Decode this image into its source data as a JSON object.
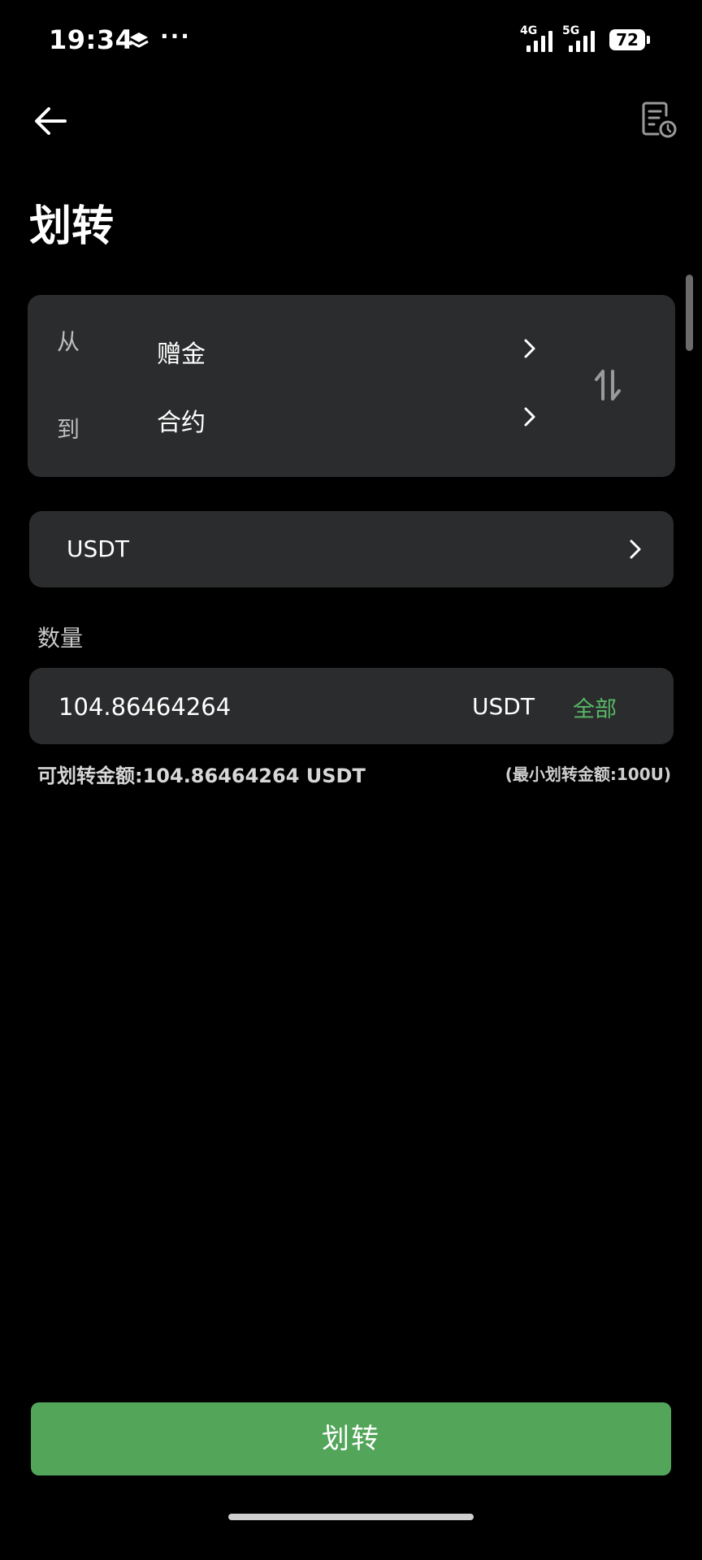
{
  "status_bar": {
    "time": "19:34",
    "more": "···",
    "network_1": "4G",
    "network_2": "5G",
    "battery": "72"
  },
  "header": {
    "title": "划转",
    "back_icon": "arrow-left-icon",
    "history_icon": "record-clock-icon"
  },
  "route": {
    "from_label": "从",
    "from_value": "赠金",
    "to_label": "到",
    "to_value": "合约",
    "swap_icon": "swap-vertical-icon"
  },
  "coin": {
    "value": "USDT"
  },
  "amount": {
    "label": "数量",
    "value": "104.86464264",
    "unit": "USDT",
    "all_label": "全部",
    "available": "可划转金额:104.86464264 USDT",
    "minimum": "(最小划转金额:100U)"
  },
  "submit": {
    "label": "划转"
  },
  "colors": {
    "background": "#000000",
    "card": "#2b2c2d",
    "accent_green": "#53a55a",
    "link_green": "#58b866"
  }
}
